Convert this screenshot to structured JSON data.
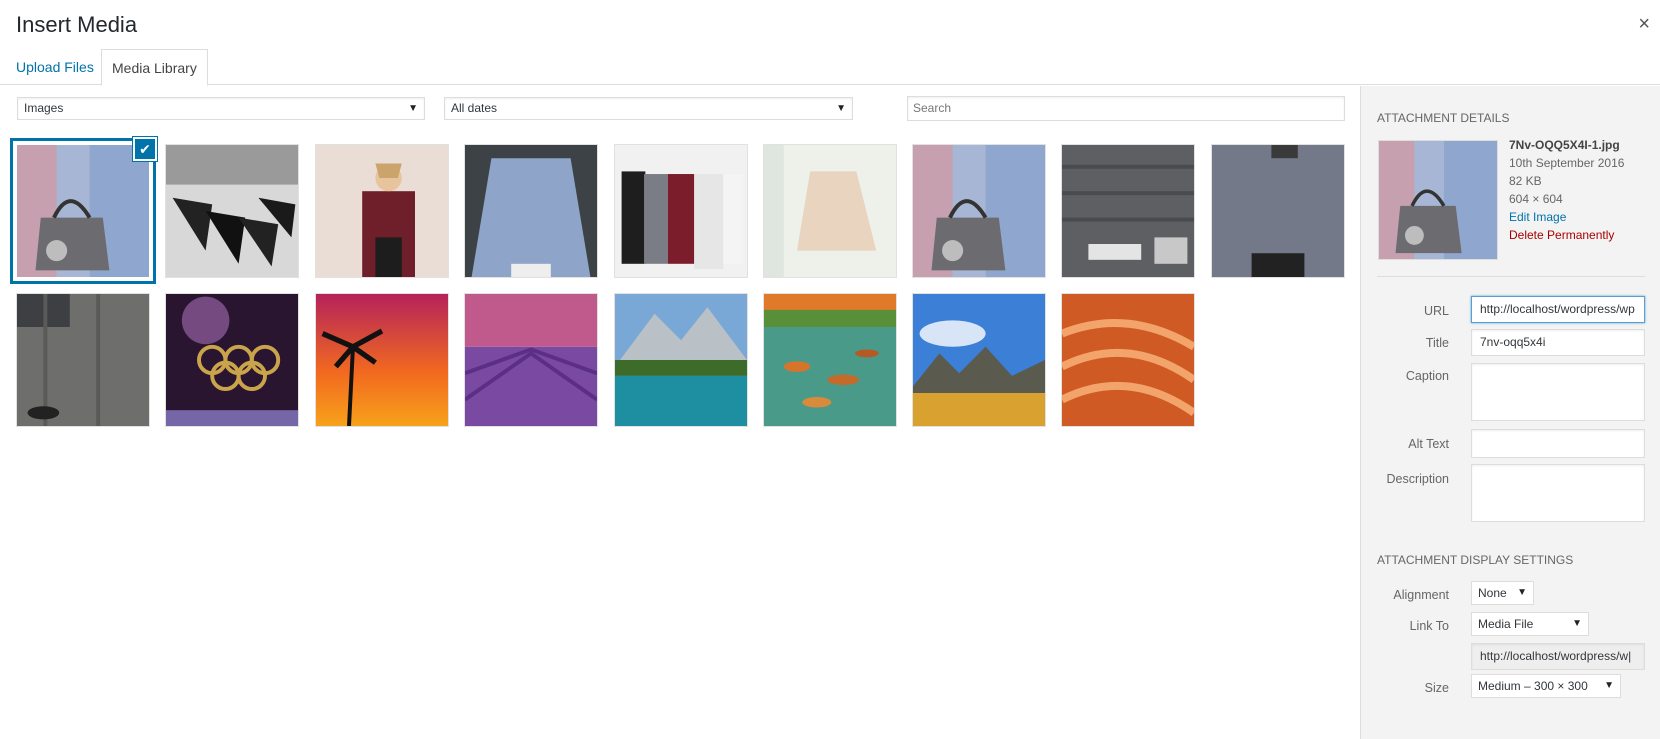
{
  "modal": {
    "title": "Insert Media",
    "close_label": "×"
  },
  "tabs": [
    {
      "label": "Upload Files"
    },
    {
      "label": "Media Library"
    }
  ],
  "toolbar": {
    "type_filter": "Images",
    "date_filter": "All dates",
    "search_placeholder": "Search"
  },
  "sidebar": {
    "details_heading": "ATTACHMENT DETAILS",
    "filename": "7Nv-OQQ5X4I-1.jpg",
    "date": "10th September 2016",
    "filesize": "82 KB",
    "dimensions": "604 × 604",
    "edit_link": "Edit Image",
    "delete_link": "Delete Permanently",
    "url_label": "URL",
    "url_value": "http://localhost/wordpress/wp",
    "title_label": "Title",
    "title_value": "7nv-oqq5x4i",
    "caption_label": "Caption",
    "alt_label": "Alt Text",
    "description_label": "Description",
    "display_heading": "ATTACHMENT DISPLAY SETTINGS",
    "alignment_label": "Alignment",
    "alignment_value": "None",
    "linkto_label": "Link To",
    "linkto_value": "Media File",
    "link_url": "http://localhost/wordpress/w|",
    "size_label": "Size",
    "size_value": "Medium – 300 × 300"
  },
  "colors": {
    "accent": "#0073aa",
    "danger": "#a00000"
  }
}
